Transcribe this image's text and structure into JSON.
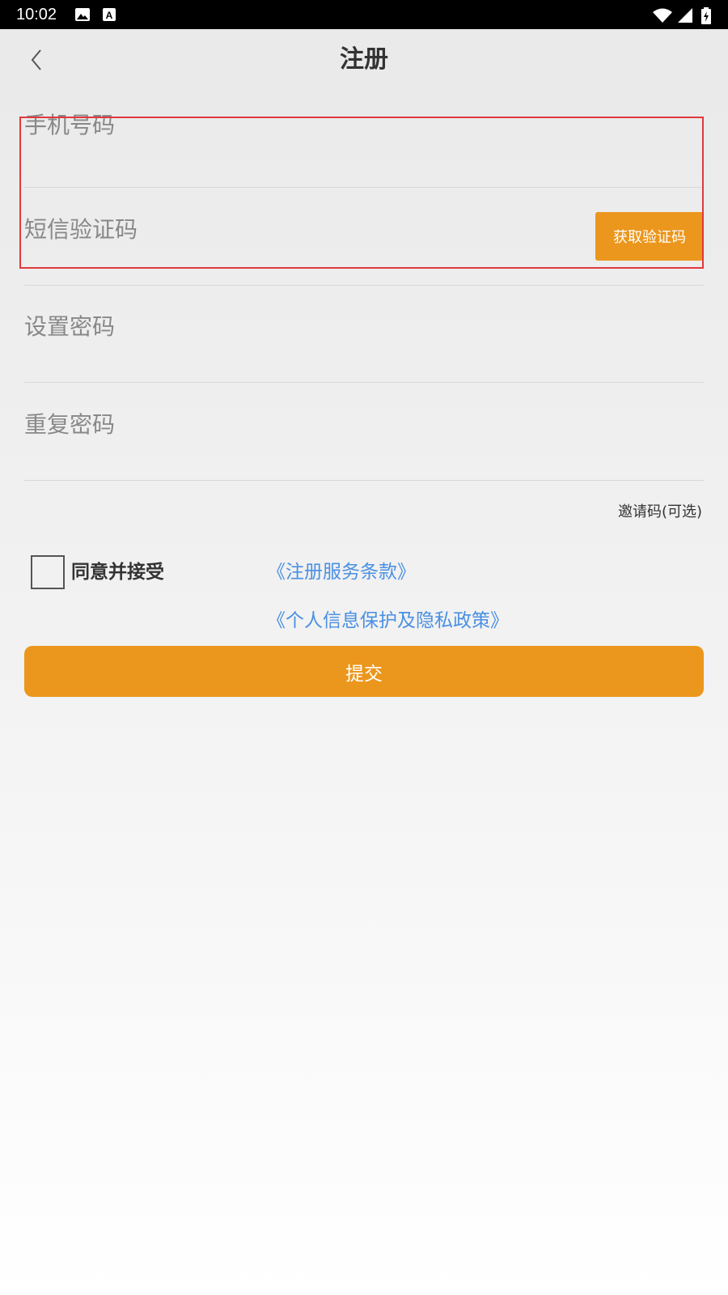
{
  "status_bar": {
    "time": "10:02",
    "icons": [
      "image-icon",
      "keyboard-a-icon",
      "wifi-icon",
      "signal-icon",
      "battery-charging-icon"
    ]
  },
  "header": {
    "back_icon": "chevron-left-icon",
    "title": "注册"
  },
  "form": {
    "phone": {
      "placeholder": "手机号码",
      "value": ""
    },
    "sms_code": {
      "placeholder": "短信验证码",
      "value": "",
      "button_label": "获取验证码"
    },
    "password": {
      "placeholder": "设置密码",
      "value": ""
    },
    "repeat_password": {
      "placeholder": "重复密码",
      "value": ""
    },
    "invite_code_label": "邀请码(可选)"
  },
  "agreement": {
    "checked": false,
    "label": "同意并接受",
    "terms_link": "《注册服务条款》",
    "privacy_link": "《个人信息保护及隐私政策》"
  },
  "submit_label": "提交",
  "colors": {
    "accent": "#eb961c",
    "link": "#4a90e2",
    "highlight": "#e0393e",
    "status_bar": "#000000"
  }
}
